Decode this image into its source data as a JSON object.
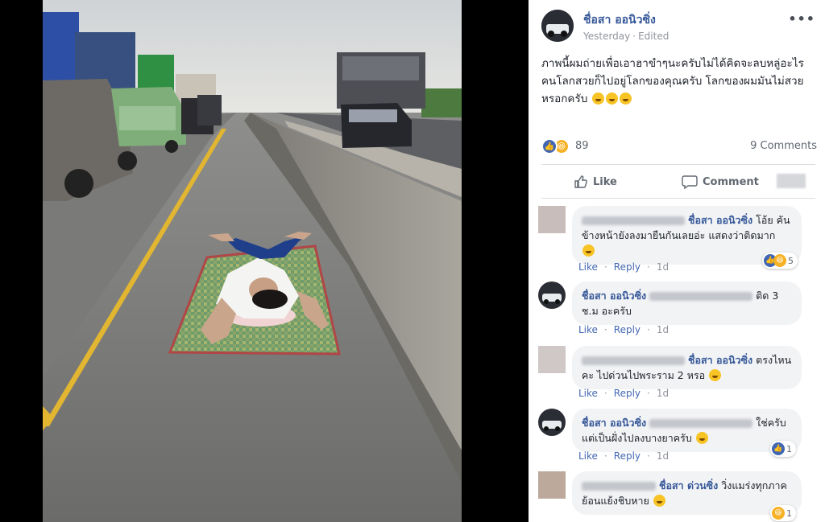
{
  "post": {
    "author": "ชื่อสา ออนิวซิ่ง",
    "time": "Yesterday",
    "edited": "Edited",
    "more_icon": "more-horizontal-icon",
    "text": "ภาพนี้ผมถ่ายเพื่อเอาฮาขำๆนะครับไม่ได้คิดจะลบหลู่อะไร คนโลกสวยก็ไปอยู่โลกของคุณครับ โลกของผมมันไม่สวย หรอกครับ",
    "text_emoji_count": 3,
    "reaction_count": "89",
    "comments_count": "9 Comments",
    "like_label": "Like",
    "comment_label": "Comment"
  },
  "colors": {
    "link": "#365899",
    "accent": "#4267b2",
    "bubble": "#f2f3f5",
    "muted": "#90949c"
  },
  "comments": [
    {
      "name": "ชื่อสา ออนิวซิ่ง",
      "text": "โอ้ย คันข้างหน้ายังลงมายืนกันเลยอ่ะ แสดงว่าติดมาก",
      "like": "Like",
      "reply": "Reply",
      "time": "1d",
      "reaction_count": "5"
    },
    {
      "name": "ชื่อสา ออนิวซิ่ง",
      "text": "ติด 3 ช.ม อะครับ",
      "like": "Like",
      "reply": "Reply",
      "time": "1d"
    },
    {
      "name": "ชื่อสา ออนิวซิ่ง",
      "text": "ตรงไหนคะ ไปด่วนไปพระราม 2 หรอ",
      "like": "Like",
      "reply": "Reply",
      "time": "1d"
    },
    {
      "name": "ชื่อสา ออนิวซิ่ง",
      "text": "ใช่ครับ แต่เป็นฝั่งไปลงบางยาครับ",
      "like": "Like",
      "reply": "Reply",
      "time": "1d",
      "reaction_count": "1"
    },
    {
      "name": "ชื่อสา ด่วนซิ่ง",
      "text": "วิ่งแมร่งทุกภาค ย้อนแย้งชิบหาย",
      "reaction_count": "1"
    }
  ]
}
